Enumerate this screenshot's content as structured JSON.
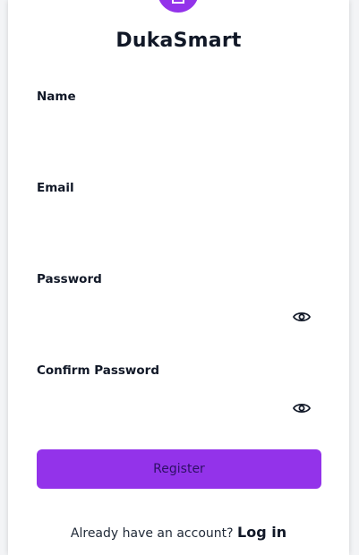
{
  "brand": {
    "name": "DukaSmart",
    "accent_color": "#9333ea"
  },
  "form": {
    "name_label": "Name",
    "name_value": "",
    "email_label": "Email",
    "email_value": "",
    "password_label": "Password",
    "password_value": "",
    "confirm_password_label": "Confirm Password",
    "confirm_password_value": "",
    "toggle_icon": "eye-icon",
    "submit_label": "Register"
  },
  "footer": {
    "prompt_text": "Already have an account?",
    "login_link_label": "Log in"
  }
}
